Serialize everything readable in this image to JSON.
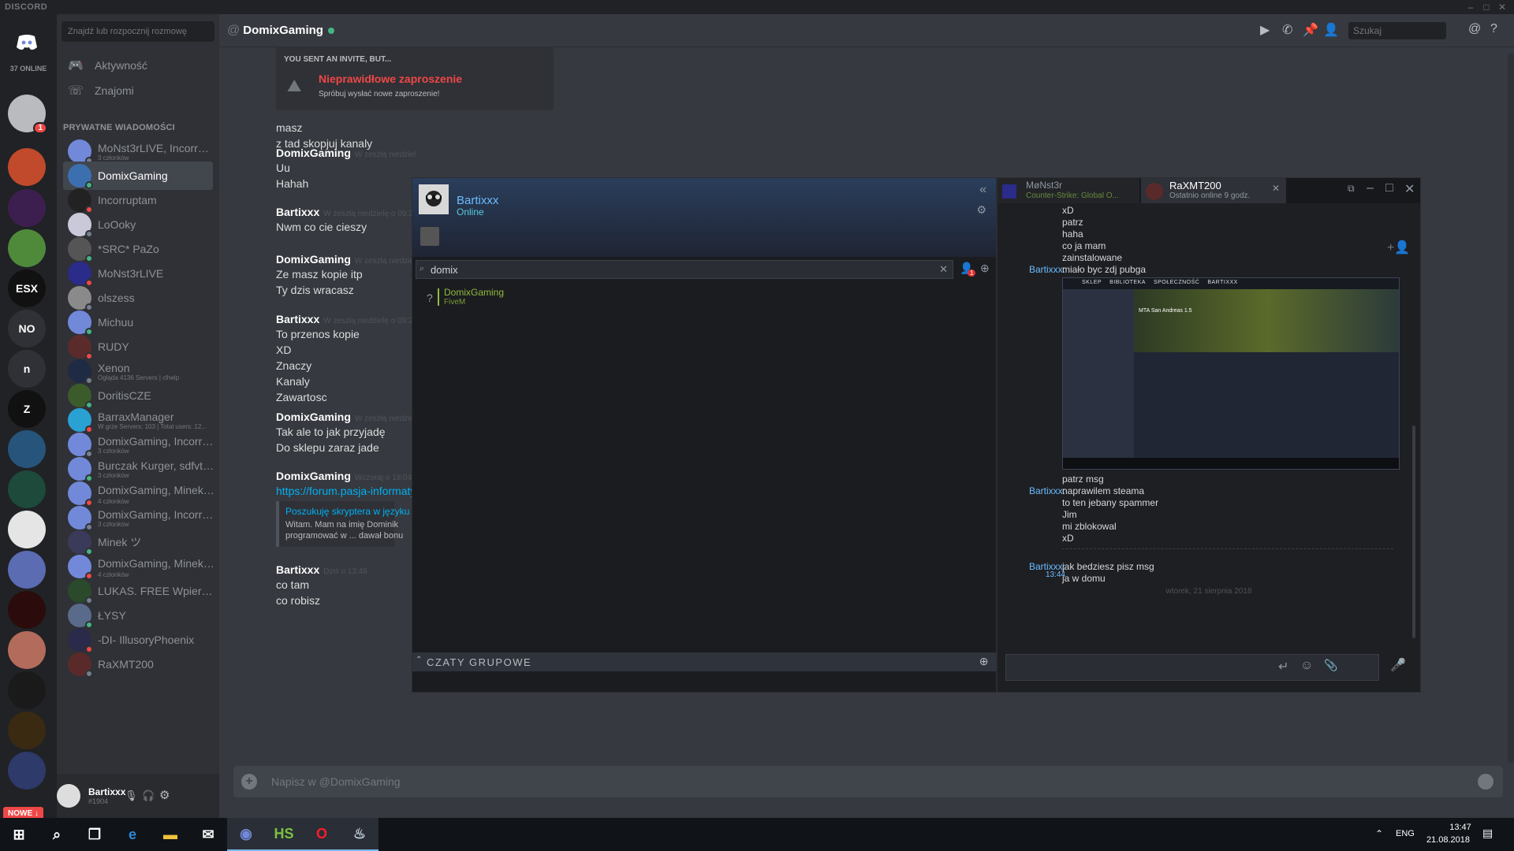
{
  "app": {
    "brand": "DISCORD",
    "online_count": "37 ONLINE"
  },
  "window_controls": [
    "–",
    "□",
    "✕"
  ],
  "servers": [
    {
      "label": "",
      "icon": "discord-home-icon",
      "color": "#7289da"
    },
    {
      "label": "",
      "icon": "group-dm-icon",
      "color": "#b9bbbe",
      "badge": "1"
    },
    {
      "label": "",
      "icon": "pikachu-server-icon",
      "color": "#c04a2b"
    },
    {
      "label": "",
      "icon": "b-server-icon",
      "color": "#3c1f4e"
    },
    {
      "label": "",
      "icon": "pepe-server-icon",
      "color": "#4f8a3b"
    },
    {
      "label": "ESX",
      "icon": "esx-server-icon",
      "color": "#111111"
    },
    {
      "label": "NO",
      "icon": "no-server-icon",
      "color": "#2f3136"
    },
    {
      "label": "n",
      "icon": "n-server-icon",
      "color": "#2f3136"
    },
    {
      "label": "Z",
      "icon": "z-server-icon",
      "color": "#111111"
    },
    {
      "label": "",
      "icon": "a-server-icon",
      "color": "#26547a"
    },
    {
      "label": "",
      "icon": "triangle-server-icon",
      "color": "#1d4a3a"
    },
    {
      "label": "",
      "icon": "mask-server-icon",
      "color": "#e5e5e5"
    },
    {
      "label": "",
      "icon": "bot-server-icon",
      "color": "#5b6cb3"
    },
    {
      "label": "",
      "icon": "rp-server-icon",
      "color": "#2b0b0b"
    },
    {
      "label": "",
      "icon": "avatar-server-icon",
      "color": "#b36b5b"
    },
    {
      "label": "",
      "icon": "pubg-server-icon",
      "color": "#1a1a1a"
    },
    {
      "label": "",
      "icon": "pubg2-server-icon",
      "color": "#3a2a12"
    },
    {
      "label": "",
      "icon": "fighter-server-icon",
      "color": "#2d3a6a"
    }
  ],
  "nowe_label": "NOWE ↓",
  "dm_sidebar": {
    "search_placeholder": "Znajdź lub rozpocznij rozmowę",
    "nav": [
      {
        "label": "Aktywność",
        "icon": "gamepad-icon"
      },
      {
        "label": "Znajomi",
        "icon": "friends-wave-icon"
      }
    ],
    "header": "PRYWATNE WIADOMOŚCI",
    "items": [
      {
        "name": "MoNst3rLIVE, Incorrupt...",
        "sub": "3 członków",
        "color": "#7289da"
      },
      {
        "name": "DomixGaming",
        "sub": "",
        "color": "#3c6fb0",
        "active": true
      },
      {
        "name": "Incorruptam",
        "sub": "",
        "color": "#222222"
      },
      {
        "name": "LoOoky",
        "sub": "",
        "color": "#c9c9d9"
      },
      {
        "name": "*SRC* PaZo",
        "sub": "",
        "color": "#555555"
      },
      {
        "name": "MoNst3rLIVE",
        "sub": "",
        "color": "#2b2b8a"
      },
      {
        "name": "olszess",
        "sub": "",
        "color": "#8a8a8a"
      },
      {
        "name": "Michuu",
        "sub": "",
        "color": "#7289da"
      },
      {
        "name": "RUDY",
        "sub": "",
        "color": "#5b2b2b"
      },
      {
        "name": "Xenon",
        "sub": "Ogląda 4136 Servers | clhelp",
        "color": "#1f2a44"
      },
      {
        "name": "DoritisCZE",
        "sub": "",
        "color": "#3b5b2b"
      },
      {
        "name": "BarraxManager",
        "sub": "W grze Servers: 103 | Total users: 12...",
        "color": "#2aa1d3"
      },
      {
        "name": "DomixGaming, Incorrup...",
        "sub": "3 członków",
        "color": "#7289da"
      },
      {
        "name": "Burczak Kurger, sdfvtgh...",
        "sub": "3 członków",
        "color": "#7289da"
      },
      {
        "name": "DomixGaming, Minek ツ...",
        "sub": "4 członków",
        "color": "#7289da"
      },
      {
        "name": "DomixGaming, Incorrup...",
        "sub": "3 członków",
        "color": "#7289da"
      },
      {
        "name": "Minek ツ",
        "sub": "",
        "color": "#3a3a5a"
      },
      {
        "name": "DomixGaming, Minek ツ...",
        "sub": "4 członków",
        "color": "#7289da"
      },
      {
        "name": "LUKAS. FREE Wpierdol ...",
        "sub": "",
        "color": "#2b4a2b"
      },
      {
        "name": "ŁYSY",
        "sub": "",
        "color": "#5a6a8a"
      },
      {
        "name": "-DI- IllusoryPhoenix",
        "sub": "",
        "color": "#2a2a4a"
      },
      {
        "name": "RaXMT200",
        "sub": "",
        "color": "#5a2a2a"
      }
    ]
  },
  "user": {
    "name": "Bartixxx",
    "tag": "#1904"
  },
  "chat": {
    "at": "@",
    "name": "DomixGaming",
    "search_placeholder": "Szukaj",
    "invite": {
      "header": "YOU SENT AN INVITE, BUT...",
      "title": "Nieprawidłowe zaproszenie",
      "sub": "Spróbuj wysłać nowe zaproszenie!"
    },
    "orphan_lines": [
      "masz",
      "z tad skopjuj kanaly"
    ],
    "messages": [
      {
        "author": "DomixGaming",
        "ts": "W zeszłą niedziel",
        "lines": [
          "Uu",
          "Hahah"
        ],
        "avatar_color": "#3c6fb0"
      },
      {
        "author": "Bartixxx",
        "ts": "W zeszłą niedzielę o 09:2",
        "lines": [
          "Nwm co cie cieszy"
        ],
        "avatar_color": "#dddddd"
      },
      {
        "author": "DomixGaming",
        "ts": "W zeszłą niedziel",
        "lines": [
          "Ze masz kopie itp",
          "Ty dzis wracasz"
        ],
        "avatar_color": "#3c6fb0"
      },
      {
        "author": "Bartixxx",
        "ts": "W zeszłą niedzielę o 09:2",
        "lines": [
          "To przenos kopie",
          "XD",
          "Znaczy",
          "Kanaly",
          "Zawartosc"
        ],
        "avatar_color": "#dddddd"
      },
      {
        "author": "DomixGaming",
        "ts": "W zeszłą niedziel",
        "lines": [
          "Tak ale to jak przyjadę",
          "Do sklepu zaraz jade"
        ],
        "avatar_color": "#3c6fb0"
      },
      {
        "author": "DomixGaming",
        "ts": "Wczoraj o 18:04",
        "lines": [
          "https://forum.pasja-informaty"
        ],
        "embed_title": "Poszukuję skryptera w języku",
        "embed_text_1": "Witam. Mam na imię Dominik",
        "embed_text_2": "programować w ... dawał bonu",
        "avatar_color": "#3c6fb0"
      },
      {
        "author": "Bartixxx",
        "ts": "Dziś o 13:46",
        "lines": [
          "co tam",
          "co robisz"
        ],
        "avatar_color": "#dddddd"
      }
    ],
    "composer_placeholder": "Napisz w @DomixGaming"
  },
  "steam_friends": {
    "user": "Bartixxx",
    "status": "Online",
    "search_value": "domix",
    "notif_count": "1",
    "result": {
      "prefix": "?",
      "name": "DomixGaming",
      "game": "FiveM"
    },
    "group_chats": "CZATY GRUPOWE"
  },
  "steam_chat": {
    "tabs": [
      {
        "name": "MøNst3r",
        "sub": "Counter-Strike: Global O..."
      },
      {
        "name": "RaXMT200",
        "sub": "Ostatnio online 9 godz."
      }
    ],
    "log_top": [
      "xD",
      "patrz",
      "haha",
      "co ja mam",
      "zainstalowane"
    ],
    "log_top_author": "Bartixxx:",
    "log_top_last": "miało byc zdj pubga",
    "screenshot_title": "MTA San Andreas 1.5",
    "screenshot_nav": [
      "SKLEP",
      "BIBLIOTEKA",
      "SPOŁECZNOŚĆ",
      "BARTIXXX"
    ],
    "log_mid_first": "patrz msg",
    "log_mid_author": "Bartixxx:",
    "log_mid": [
      "naprawilem steama",
      "to ten jebany spammer",
      "Jim",
      "mi zblokowal",
      "xD"
    ],
    "log_last_author": "Bartixxx:",
    "log_last_time": "13:44",
    "log_last": [
      "jak bedziesz pisz msg",
      "ja w domu"
    ],
    "divider": "wtorek, 21 sierpnia 2018"
  },
  "taskbar": {
    "lang": "ENG",
    "time": "13:47",
    "date": "21.08.2018",
    "apps": [
      "windows-start-icon",
      "search-icon",
      "task-view-icon",
      "edge-icon",
      "file-explorer-icon",
      "mail-icon",
      "discord-icon",
      "hs-icon",
      "opera-icon",
      "steam-icon"
    ]
  }
}
